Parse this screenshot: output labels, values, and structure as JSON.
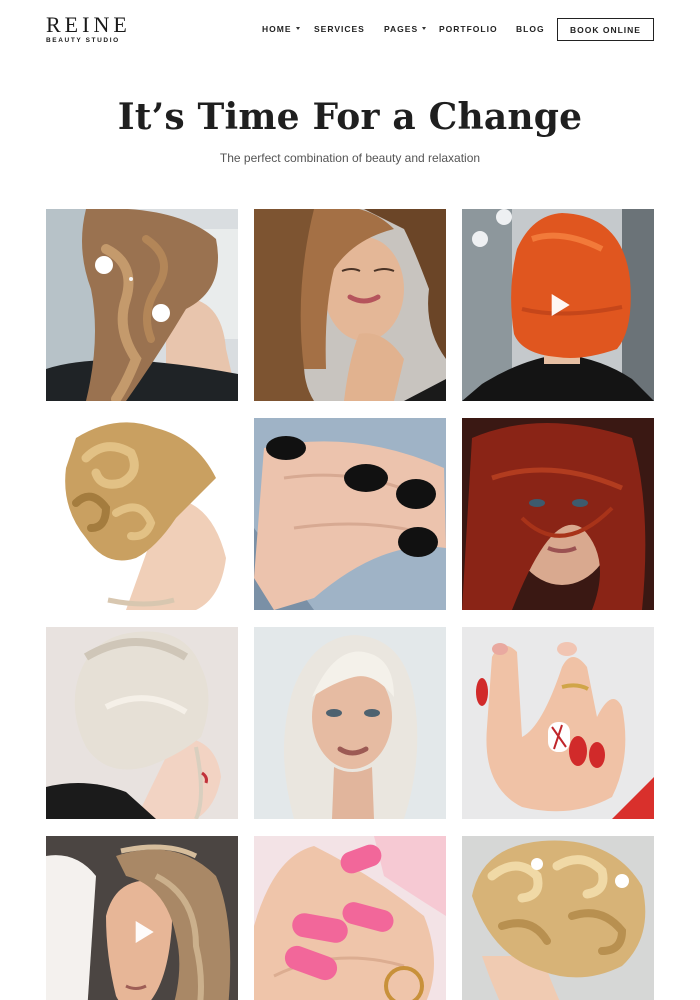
{
  "brand": {
    "name": "REINE",
    "tagline": "BEAUTY STUDIO"
  },
  "nav": {
    "items": [
      {
        "label": "HOME",
        "has_dropdown": true
      },
      {
        "label": "SERVICES",
        "has_dropdown": false
      },
      {
        "label": "PAGES",
        "has_dropdown": true
      },
      {
        "label": "PORTFOLIO",
        "has_dropdown": false
      },
      {
        "label": "BLOG",
        "has_dropdown": false
      }
    ],
    "cta": "BOOK ONLINE"
  },
  "hero": {
    "title": "It’s Time For a Change",
    "subtitle": "The perfect combination of beauty and relaxation"
  },
  "gallery": {
    "tiles": [
      {
        "subject": "braided-hair-with-flowers",
        "video": false
      },
      {
        "subject": "woman-with-curly-brown-hair",
        "video": false
      },
      {
        "subject": "red-bob-haircut",
        "video": true
      },
      {
        "subject": "blonde-updo-curls",
        "video": false
      },
      {
        "subject": "black-manicure-nails",
        "video": false
      },
      {
        "subject": "red-hair-portrait",
        "video": false
      },
      {
        "subject": "platinum-messy-bun",
        "video": false
      },
      {
        "subject": "platinum-blonde-portrait",
        "video": false
      },
      {
        "subject": "red-manicure-hand",
        "video": false
      },
      {
        "subject": "wavy-hair-profile",
        "video": true
      },
      {
        "subject": "pink-manicure-nails",
        "video": false
      },
      {
        "subject": "blonde-curled-updo",
        "video": false
      }
    ]
  },
  "colors": {
    "text": "#1f1f1f",
    "subtle": "#555555",
    "auburn": "#e0561f",
    "red_hair": "#8a2416",
    "blonde": "#c9a061",
    "platinum": "#e6e0d6"
  }
}
